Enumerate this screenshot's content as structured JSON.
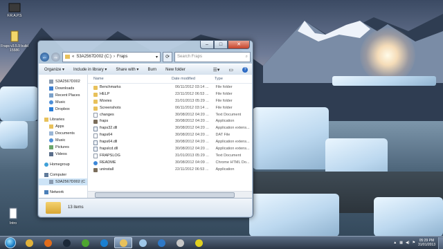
{
  "desktop": {
    "icons": [
      {
        "label": "F.R.A.P.S"
      },
      {
        "label": "Fraps v3.5.9 build 15586"
      },
      {
        "label": "Intro"
      }
    ]
  },
  "window": {
    "address": {
      "prefix": "«",
      "drive": "S3A2567D002 (C:)",
      "sep": "›",
      "folder": "Fraps",
      "dropdown": "▾"
    },
    "search_placeholder": "Search Fraps",
    "toolbar": {
      "organize": "Organize ▾",
      "include": "Include in library ▾",
      "share": "Share with ▾",
      "burn": "Burn",
      "new_folder": "New folder"
    },
    "nav": {
      "favorites": [
        {
          "label": "S3A2567D002",
          "icon": "drive-icon"
        },
        {
          "label": "Downloads",
          "icon": "download-folder-icon"
        },
        {
          "label": "Recent Places",
          "icon": "recent-places-icon"
        },
        {
          "label": "Music",
          "icon": "music-icon"
        },
        {
          "label": "Dropbox",
          "icon": "dropbox-icon"
        }
      ],
      "libraries_label": "Libraries",
      "libraries": [
        {
          "label": "Apps"
        },
        {
          "label": "Documents"
        },
        {
          "label": "Music"
        },
        {
          "label": "Pictures"
        },
        {
          "label": "Videos"
        }
      ],
      "homegroup": "Homegroup",
      "computer": "Computer",
      "computer_items": [
        {
          "label": "S3A2567D002 (C"
        }
      ],
      "network": "Network"
    },
    "columns": {
      "name": "Name",
      "date": "Date modified",
      "type": "Type"
    },
    "files": [
      {
        "name": "Benchmarks",
        "date": "06/11/2012 03:14 ...",
        "type": "File folder",
        "kind": "folder"
      },
      {
        "name": "HELP",
        "date": "22/11/2012 06:53 ...",
        "type": "File folder",
        "kind": "folder"
      },
      {
        "name": "Movies",
        "date": "31/01/2013 05:29 ...",
        "type": "File folder",
        "kind": "folder"
      },
      {
        "name": "Screenshots",
        "date": "06/11/2012 03:14 ...",
        "type": "File folder",
        "kind": "folder"
      },
      {
        "name": "changes",
        "date": "30/08/2012 04:20 ...",
        "type": "Text Document",
        "kind": "doc"
      },
      {
        "name": "fraps",
        "date": "30/08/2012 04:20 ...",
        "type": "Application",
        "kind": "app"
      },
      {
        "name": "fraps32.dll",
        "date": "30/08/2012 04:20 ...",
        "type": "Application extens...",
        "kind": "dll"
      },
      {
        "name": "fraps64",
        "date": "30/08/2012 04:20 ...",
        "type": "DAT File",
        "kind": "doc"
      },
      {
        "name": "fraps64.dll",
        "date": "30/08/2012 04:20 ...",
        "type": "Application extens...",
        "kind": "dll"
      },
      {
        "name": "frapslcd.dll",
        "date": "30/08/2012 04:20 ...",
        "type": "Application extens...",
        "kind": "dll"
      },
      {
        "name": "FRAPSLOG",
        "date": "31/01/2013 05:29 ...",
        "type": "Text Document",
        "kind": "doc"
      },
      {
        "name": "README",
        "date": "30/08/2012 04:09 ...",
        "type": "Chrome HTML Do...",
        "kind": "ie"
      },
      {
        "name": "uninstall",
        "date": "22/11/2012 06:53 ...",
        "type": "Application",
        "kind": "app"
      }
    ],
    "status": {
      "count": "13 items"
    }
  },
  "taskbar": {
    "buttons": [
      {
        "name": "taskbar-start-button",
        "icon": "windows-orb-icon",
        "color": "#1d7fc6"
      },
      {
        "name": "taskbar-chrome-button",
        "icon": "chrome-icon",
        "color": "#e0b13a"
      },
      {
        "name": "taskbar-firefox-button",
        "icon": "firefox-icon",
        "color": "#e06c1c"
      },
      {
        "name": "taskbar-steam-button",
        "icon": "steam-icon",
        "color": "#1b2838"
      },
      {
        "name": "taskbar-utorrent-button",
        "icon": "utorrent-icon",
        "color": "#4da630"
      },
      {
        "name": "taskbar-media-player-button",
        "icon": "media-player-icon",
        "color": "#1a7fd0"
      },
      {
        "name": "taskbar-explorer-button",
        "icon": "explorer-folder-icon",
        "color": "#e8c15b"
      },
      {
        "name": "taskbar-notepad-button",
        "icon": "notepad-icon",
        "color": "#9ec7e8"
      },
      {
        "name": "taskbar-gadget-button",
        "icon": "speed-gauge-icon",
        "color": "#2e78c6"
      },
      {
        "name": "taskbar-hamster-button",
        "icon": "hamster-icon",
        "color": "#c7c7c7"
      },
      {
        "name": "taskbar-fraps-button",
        "icon": "fraps-icon",
        "color": "#e0d020"
      }
    ],
    "time": "05:29 PM",
    "date": "31/01/2013"
  }
}
